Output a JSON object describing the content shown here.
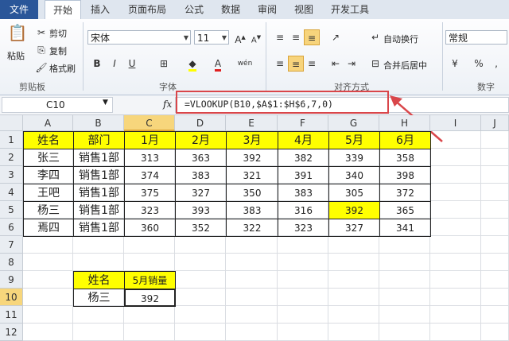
{
  "tabs": [
    "文件",
    "开始",
    "插入",
    "页面布局",
    "公式",
    "数据",
    "审阅",
    "视图",
    "开发工具"
  ],
  "active_tab": 1,
  "ribbon": {
    "clipboard": {
      "paste": "粘贴",
      "cut": "剪切",
      "copy": "复制",
      "format_painter": "格式刷",
      "label": "剪贴板"
    },
    "font": {
      "name": "宋体",
      "size": "11",
      "label": "字体",
      "bold": "B",
      "italic": "I",
      "underline": "U",
      "grow": "A",
      "shrink": "A",
      "wen": "wén"
    },
    "align": {
      "wrap": "自动换行",
      "merge": "合并后居中",
      "label": "对齐方式"
    },
    "number": {
      "format": "常规",
      "label": "数字",
      "percent": "%"
    }
  },
  "formula_bar": {
    "name_box": "C10",
    "fx": "fx",
    "formula": "=VLOOKUP(B10,$A$1:$H$6,7,0)"
  },
  "columns": [
    "A",
    "B",
    "C",
    "D",
    "E",
    "F",
    "G",
    "H",
    "I",
    "J"
  ],
  "rows": [
    "1",
    "2",
    "3",
    "4",
    "5",
    "6",
    "7",
    "8",
    "9",
    "10",
    "11",
    "12"
  ],
  "table": {
    "header": [
      "姓名",
      "部门",
      "1月",
      "2月",
      "3月",
      "4月",
      "5月",
      "6月"
    ],
    "rows": [
      [
        "张三",
        "销售1部",
        "313",
        "363",
        "392",
        "382",
        "339",
        "358"
      ],
      [
        "李四",
        "销售1部",
        "374",
        "383",
        "321",
        "391",
        "340",
        "398"
      ],
      [
        "王吧",
        "销售1部",
        "375",
        "327",
        "350",
        "383",
        "305",
        "372"
      ],
      [
        "杨三",
        "销售1部",
        "323",
        "393",
        "383",
        "316",
        "392",
        "365"
      ],
      [
        "焉四",
        "销售1部",
        "360",
        "352",
        "322",
        "323",
        "327",
        "341"
      ]
    ]
  },
  "lookup": {
    "header": [
      "姓名",
      "5月销量"
    ],
    "values": [
      "杨三",
      "392"
    ]
  },
  "colors": {
    "highlight": "#ffff00",
    "annotation": "#d9464a"
  }
}
